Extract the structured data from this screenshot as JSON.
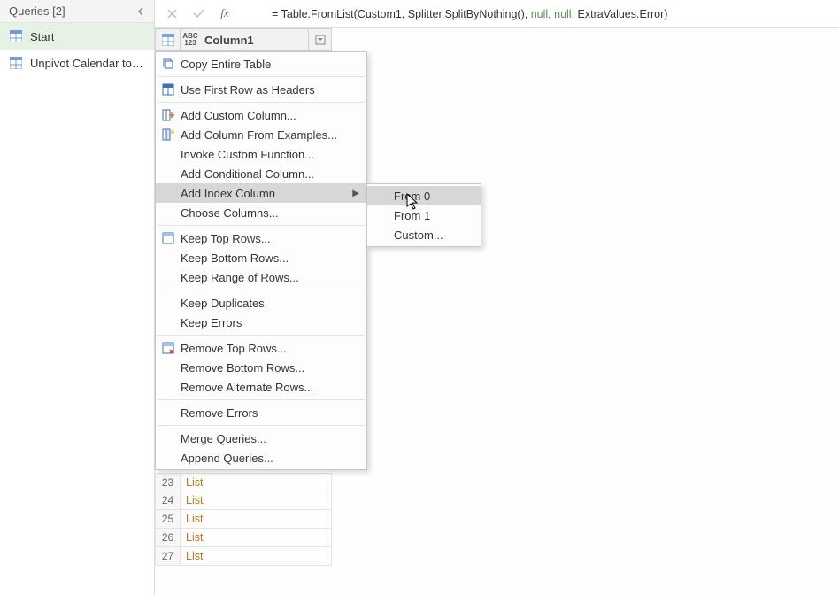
{
  "queries": {
    "header": "Queries [2]",
    "items": [
      {
        "label": "Start",
        "selected": true
      },
      {
        "label": "Unpivot Calendar to T...",
        "selected": false
      }
    ]
  },
  "formula_bar": {
    "prefix": "= Table.FromList(Custom1, Splitter.SplitByNothing(), ",
    "null1": "null",
    "sep1": ", ",
    "null2": "null",
    "suffix": ", ExtraValues.Error)"
  },
  "column_header": {
    "type_top": "ABC",
    "type_bottom": "123",
    "name": "Column1"
  },
  "context_menu": [
    {
      "kind": "item",
      "icon": "copy",
      "label": "Copy Entire Table"
    },
    {
      "kind": "sep"
    },
    {
      "kind": "item",
      "icon": "headers",
      "label": "Use First Row as Headers"
    },
    {
      "kind": "sep"
    },
    {
      "kind": "item",
      "icon": "addcol",
      "label": "Add Custom Column..."
    },
    {
      "kind": "item",
      "icon": "examples",
      "label": "Add Column From Examples..."
    },
    {
      "kind": "item",
      "icon": "",
      "label": "Invoke Custom Function..."
    },
    {
      "kind": "item",
      "icon": "",
      "label": "Add Conditional Column..."
    },
    {
      "kind": "item",
      "icon": "",
      "label": "Add Index Column",
      "submenu": true,
      "highlight": true
    },
    {
      "kind": "item",
      "icon": "",
      "label": "Choose Columns..."
    },
    {
      "kind": "sep"
    },
    {
      "kind": "item",
      "icon": "toprows",
      "label": "Keep Top Rows..."
    },
    {
      "kind": "item",
      "icon": "",
      "label": "Keep Bottom Rows..."
    },
    {
      "kind": "item",
      "icon": "",
      "label": "Keep Range of Rows..."
    },
    {
      "kind": "sep"
    },
    {
      "kind": "item",
      "icon": "",
      "label": "Keep Duplicates"
    },
    {
      "kind": "item",
      "icon": "",
      "label": "Keep Errors"
    },
    {
      "kind": "sep"
    },
    {
      "kind": "item",
      "icon": "removerows",
      "label": "Remove Top Rows..."
    },
    {
      "kind": "item",
      "icon": "",
      "label": "Remove Bottom Rows..."
    },
    {
      "kind": "item",
      "icon": "",
      "label": "Remove Alternate Rows..."
    },
    {
      "kind": "sep"
    },
    {
      "kind": "item",
      "icon": "",
      "label": "Remove Errors"
    },
    {
      "kind": "sep"
    },
    {
      "kind": "item",
      "icon": "",
      "label": "Merge Queries..."
    },
    {
      "kind": "item",
      "icon": "",
      "label": "Append Queries..."
    }
  ],
  "submenu": [
    {
      "label": "From 0",
      "highlight": true
    },
    {
      "label": "From 1"
    },
    {
      "label": "Custom..."
    }
  ],
  "data_rows": [
    {
      "idx": "23",
      "val": "List"
    },
    {
      "idx": "24",
      "val": "List"
    },
    {
      "idx": "25",
      "val": "List"
    },
    {
      "idx": "26",
      "val": "List"
    },
    {
      "idx": "27",
      "val": "List"
    }
  ]
}
